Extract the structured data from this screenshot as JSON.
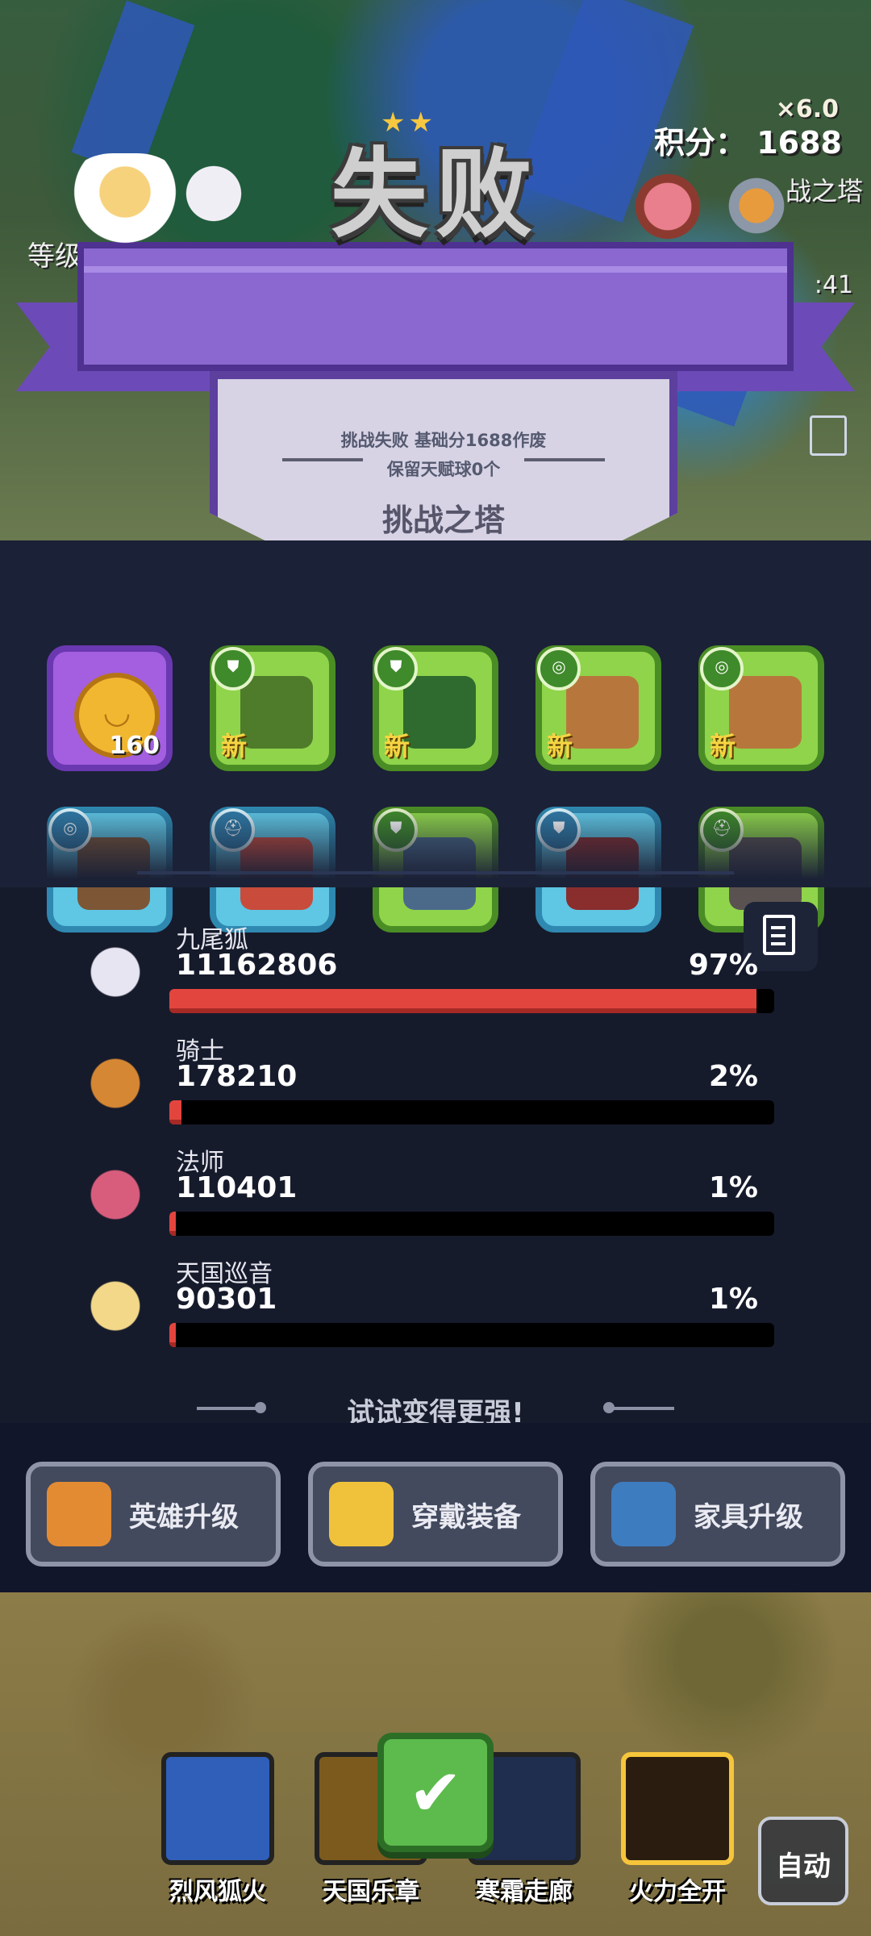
{
  "result": {
    "title": "失败",
    "stars": "★★",
    "multiplier": "×6.0",
    "score_label": "积分： 1688",
    "left_label": "等级",
    "right_label": "战之塔",
    "timer": ":41"
  },
  "shield": {
    "line1": "挑战失败 基础分1688作废",
    "line2": "保留天赋球0个",
    "name": "挑战之塔"
  },
  "rewards": [
    {
      "kind": "gold",
      "qty": "160",
      "new": "",
      "tag": "",
      "icon": "coin-icon",
      "color": "#f2b730"
    },
    {
      "kind": "green",
      "qty": "",
      "new": "新",
      "tag": "⛊",
      "icon": "leaf-armor-icon",
      "color": "#4f7c2a"
    },
    {
      "kind": "green",
      "qty": "",
      "new": "新",
      "tag": "⛊",
      "icon": "boot-icon",
      "color": "#2f6b2e"
    },
    {
      "kind": "green",
      "qty": "",
      "new": "新",
      "tag": "◎",
      "icon": "necklace-icon",
      "color": "#b7773c"
    },
    {
      "kind": "green",
      "qty": "",
      "new": "新",
      "tag": "◎",
      "icon": "necklace-icon",
      "color": "#b7773c"
    },
    {
      "kind": "blue",
      "qty": "",
      "new": "",
      "tag": "◎",
      "icon": "rope-icon",
      "color": "#7d5636"
    },
    {
      "kind": "blue",
      "qty": "",
      "new": "",
      "tag": "⛑",
      "icon": "crown-icon",
      "color": "#c94b3b"
    },
    {
      "kind": "green",
      "qty": "",
      "new": "",
      "tag": "⛊",
      "icon": "armor-icon",
      "color": "#4b6a8a"
    },
    {
      "kind": "blue",
      "qty": "",
      "new": "",
      "tag": "⛊",
      "icon": "boot-icon",
      "color": "#8a2d2d"
    },
    {
      "kind": "green",
      "qty": "",
      "new": "",
      "tag": "⛑",
      "icon": "helmet-icon",
      "color": "#5a5250"
    }
  ],
  "damage": [
    {
      "name": "九尾狐",
      "value": "11162806",
      "pct": "97%",
      "fill": 0.97,
      "avatar": "fox-avatar",
      "color": "#e7e5f2"
    },
    {
      "name": "骑士",
      "value": "178210",
      "pct": "2%",
      "fill": 0.02,
      "avatar": "knight-avatar",
      "color": "#d58733"
    },
    {
      "name": "法师",
      "value": "110401",
      "pct": "1%",
      "fill": 0.01,
      "avatar": "witch-avatar",
      "color": "#d85d7c"
    },
    {
      "name": "天国巡音",
      "value": "90301",
      "pct": "1%",
      "fill": 0.01,
      "avatar": "angel-avatar",
      "color": "#f3d889"
    }
  ],
  "tip": "试试变得更强!",
  "actions": [
    {
      "label": "英雄升级",
      "icon": "hero-icon",
      "color": "#e38b33"
    },
    {
      "label": "穿戴装备",
      "icon": "equip-icon",
      "color": "#f0c23c"
    },
    {
      "label": "家具升级",
      "icon": "hammer-icon",
      "color": "#3e7cc0"
    }
  ],
  "skills": [
    {
      "name": "烈风狐火",
      "color": "#2f5fb8"
    },
    {
      "name": "天国乐章",
      "color": "#7c5a1e"
    },
    {
      "name": "寒霜走廊",
      "color": "#1f2e4f"
    },
    {
      "name": "火力全开",
      "color": "#2a1d10"
    }
  ],
  "confirm_icon": "✔",
  "auto_label": "自动"
}
